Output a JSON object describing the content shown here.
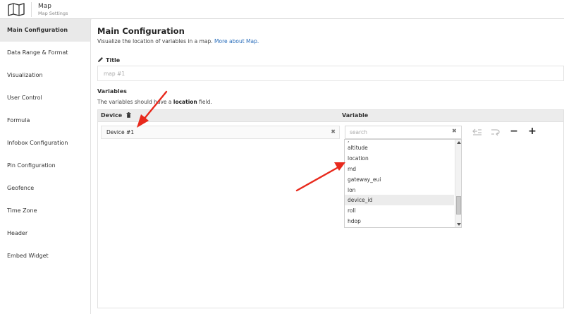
{
  "header": {
    "title": "Map",
    "subtitle": "Map Settings",
    "icon": "map-icon"
  },
  "sidebar": {
    "items": [
      {
        "label": "Main Configuration",
        "active": true
      },
      {
        "label": "Data Range & Format",
        "active": false
      },
      {
        "label": "Visualization",
        "active": false
      },
      {
        "label": "User Control",
        "active": false
      },
      {
        "label": "Formula",
        "active": false
      },
      {
        "label": "Infobox Configuration",
        "active": false
      },
      {
        "label": "Pin Configuration",
        "active": false
      },
      {
        "label": "Geofence",
        "active": false
      },
      {
        "label": "Time Zone",
        "active": false
      },
      {
        "label": "Header",
        "active": false
      },
      {
        "label": "Embed Widget",
        "active": false
      }
    ]
  },
  "main": {
    "title": "Main Configuration",
    "description": "Visualize the location of variables in a map.",
    "description_link": "More about Map.",
    "title_field": {
      "label": "Title",
      "placeholder": "map #1"
    },
    "variables": {
      "label": "Variables",
      "description_pre": "The variables should have a",
      "description_bold": "location",
      "description_post": "field.",
      "columns": {
        "device": "Device",
        "variable": "Variable"
      },
      "row": {
        "device_value": "Device #1",
        "variable_placeholder": "search"
      },
      "controls": {
        "minus": "−",
        "plus": "+"
      },
      "dropdown_options": [
        "altitude",
        "location",
        "md",
        "gateway_eui",
        "lon",
        "device_id",
        "roll",
        "hdop"
      ],
      "dropdown_hovered": "device_id"
    }
  },
  "colors": {
    "link": "#2a6ebb",
    "annotation_arrow": "#e8291c",
    "active_item_bg": "#e9e9e9"
  }
}
